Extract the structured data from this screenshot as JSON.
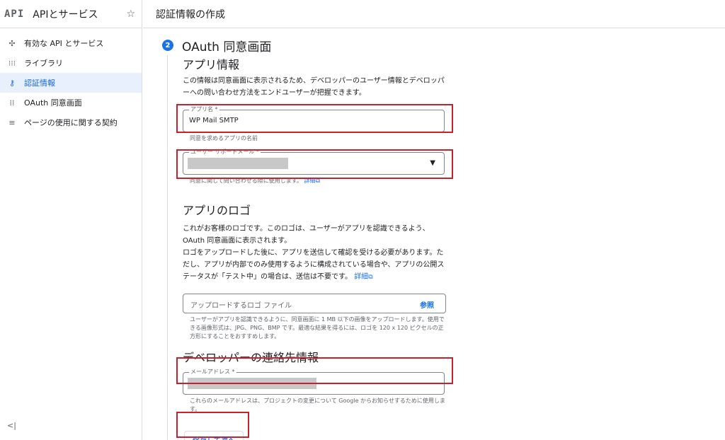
{
  "sidebar": {
    "logo": "API",
    "title": "APIとサービス",
    "pin_icon": "pin-star-icon",
    "items": [
      {
        "label": "有効な API とサービス",
        "icon": "api-diamond-icon",
        "glyph": "✣"
      },
      {
        "label": "ライブラリ",
        "icon": "library-icon",
        "glyph": "⁝⁝⁝"
      },
      {
        "label": "認証情報",
        "icon": "key-icon",
        "glyph": "⚷"
      },
      {
        "label": "OAuth 同意画面",
        "icon": "consent-icon",
        "glyph": "⁞⁞"
      },
      {
        "label": "ページの使用に関する契約",
        "icon": "agreement-icon",
        "glyph": "≡"
      }
    ],
    "collapse_label": "<|"
  },
  "header": {
    "title": "認証情報の作成"
  },
  "step": {
    "number": "2",
    "title": "OAuth 同意画面"
  },
  "app_info": {
    "title": "アプリ情報",
    "description": "この情報は同意画面に表示されるため、デベロッパーのユーザー情報とデベロッパーへの問い合わせ方法をエンドユーザーが把握できます。",
    "app_name_label": "アプリ名 *",
    "app_name_value": "WP Mail SMTP",
    "app_name_hint": "同意を求めるアプリの名前",
    "support_email_label": "ユーザー サポートメール *",
    "support_email_hint": "同意に関して問い合わせる際に使用します。",
    "support_email_link": "詳細"
  },
  "logo_section": {
    "title": "アプリのロゴ",
    "description_1": "これがお客様のロゴです。このロゴは、ユーザーがアプリを認識できるよう、OAuth 同意画面に表示されます。",
    "description_2": "ロゴをアップロードした後に、アプリを送信して確認を受ける必要があります。ただし、アプリが内部でのみ使用するように構成されている場合や、アプリの公開ステータスが「テスト中」の場合は、送信は不要です。",
    "link": "詳細",
    "upload_placeholder": "アップロードするロゴ ファイル",
    "upload_button": "参照",
    "hint": "ユーザーがアプリを認識できるように、同意画面に 1 MB 以下の画像をアップロードします。使用できる画像形式は、JPG、PNG、BMP です。最適な結果を得るには、ロゴを 120 x 120 ピクセルの正方形にすることをおすすめします。"
  },
  "developer": {
    "title": "デベロッパーの連絡先情報",
    "email_label": "メールアドレス *",
    "hint": "これらのメールアドレスは、プロジェクトの変更について Google からお知らせするために使用します。"
  },
  "actions": {
    "save_label": "保存して次へ"
  },
  "colors": {
    "accent": "#1a73e8",
    "highlight_box": "#c8202d",
    "active_bg": "#e8f0fe"
  }
}
